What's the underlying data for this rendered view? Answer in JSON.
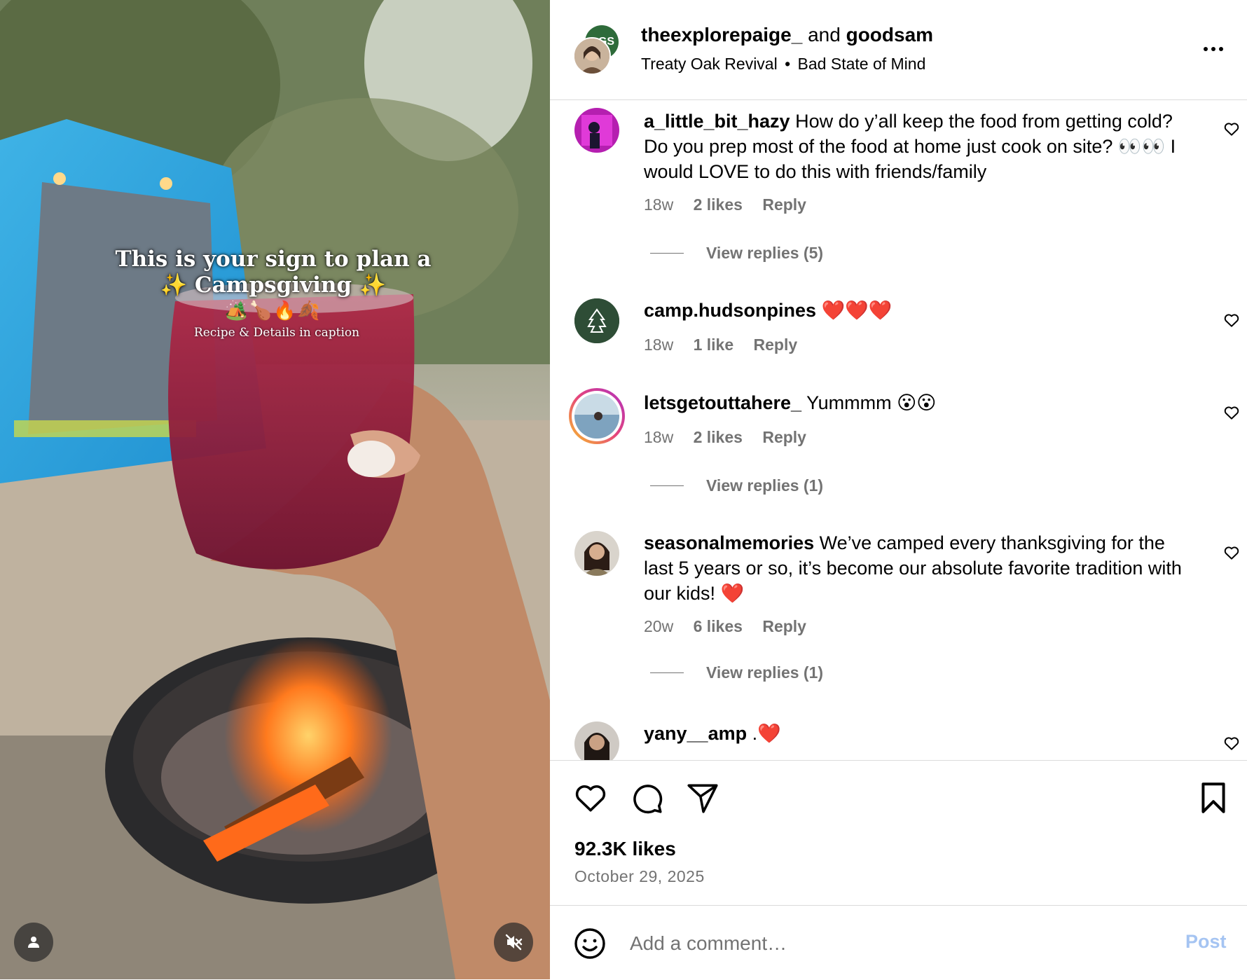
{
  "media": {
    "overlay_title": "This is your sign to plan a ✨ Campsgiving ✨",
    "overlay_emojis": "🏕️🍗🔥🍂",
    "overlay_caption": "Recipe & Details in caption",
    "user_icon": "person-icon",
    "mute_icon": "speaker-muted-icon"
  },
  "post": {
    "author1": "theexplorepaige_",
    "joiner": " and ",
    "author2": "goodsam",
    "audio_artist": "Treaty Oak Revival",
    "audio_separator": "•",
    "audio_track": "Bad State of Mind",
    "likes": "92.3K likes",
    "date": "October 29, 2025"
  },
  "comments": [
    {
      "user": "a_little_bit_hazy",
      "text": " How do y’all keep the food from getting cold? Do you prep most of the food at home just cook on site? 👀👀 I would LOVE to do this with friends/family",
      "time": "18w",
      "likes": "2 likes",
      "reply": "Reply",
      "view_replies": "View replies (5)"
    },
    {
      "user": "camp.hudsonpines",
      "text": " ❤️❤️❤️",
      "time": "18w",
      "likes": "1 like",
      "reply": "Reply"
    },
    {
      "user": "letsgetouttahere_",
      "text": " Yummmm 😮😮",
      "time": "18w",
      "likes": "2 likes",
      "reply": "Reply",
      "view_replies": "View replies (1)"
    },
    {
      "user": "seasonalmemories",
      "text": " We’ve camped every thanksgiving for the last 5 years or so, it’s become our absolute favorite tradition with our kids! ❤️",
      "time": "20w",
      "likes": "6 likes",
      "reply": "Reply",
      "view_replies": "View replies (1)"
    },
    {
      "user": "yany__amp",
      "text": " .❤️"
    }
  ],
  "add_comment": {
    "placeholder": "Add a comment…",
    "post_label": "Post"
  },
  "colors": {
    "muted_text": "#737373",
    "post_button_disabled": "#a5c4f2",
    "divider": "#dbdbdb"
  }
}
